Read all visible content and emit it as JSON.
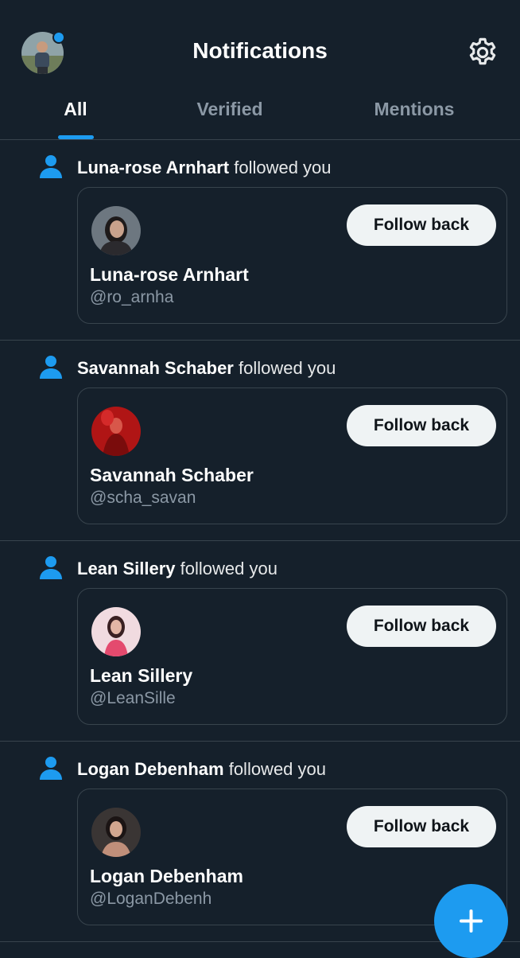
{
  "header": {
    "title": "Notifications",
    "settings_icon": "gear-icon",
    "has_unread_dot": true
  },
  "tabs": [
    {
      "label": "All",
      "active": true
    },
    {
      "label": "Verified",
      "active": false
    },
    {
      "label": "Mentions",
      "active": false
    }
  ],
  "notifications": [
    {
      "type": "follow",
      "icon": "person-icon",
      "name": "Luna-rose Arnhart",
      "action": "followed you",
      "handle": "@ro_arnha",
      "button": "Follow back"
    },
    {
      "type": "follow",
      "icon": "person-icon",
      "name": "Savannah Schaber",
      "action": "followed you",
      "handle": "@scha_savan",
      "button": "Follow back"
    },
    {
      "type": "follow",
      "icon": "person-icon",
      "name": "Lean Sillery",
      "action": "followed you",
      "handle": "@LeanSille",
      "button": "Follow back"
    },
    {
      "type": "follow",
      "icon": "person-icon",
      "name": "Logan Debenham",
      "action": "followed you",
      "handle": "@LoganDebenh",
      "button": "Follow back"
    }
  ],
  "fab": {
    "icon": "plus-icon"
  },
  "colors": {
    "background": "#15202b",
    "accent": "#1d9bf0",
    "text_primary": "#ffffff",
    "text_secondary": "#8b98a5",
    "border": "#38444d",
    "button_bg": "#eff3f4"
  }
}
